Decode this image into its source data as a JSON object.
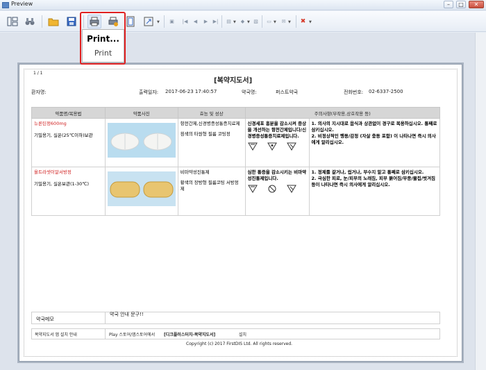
{
  "window": {
    "title": "Preview",
    "min": "–",
    "max": "□",
    "close": "✕"
  },
  "toolbar": {
    "icons": [
      "panes-icon",
      "binoculars-icon",
      "open-folder-icon",
      "save-icon",
      "print-icon",
      "quick-print-icon",
      "page-setup-icon",
      "scale-icon"
    ]
  },
  "print_menu": {
    "item_primary": "Print...",
    "item_secondary": "Print"
  },
  "document": {
    "page_counter": "1 / 1",
    "title": "[복약지도서]",
    "header": {
      "patient_label": "환자명:",
      "print_date_label": "출력일자:",
      "print_date_value": "2017-06-23 17:40:57",
      "pharmacy_label": "약국명:",
      "pharmacy_value": "퍼스트약국",
      "phone_label": "전화번호:",
      "phone_value": "02-6337-2500"
    },
    "columns": [
      "약품명/복용법",
      "약품사진",
      "효능 및 성상",
      "주의사항(부작용,상호작용 등)"
    ],
    "rows": [
      {
        "name": "뉴론틴정600mg",
        "storage": "기밀용기, 실온(25℃이하)보관",
        "efficacy": "항전간제,신경병증성통증치료제",
        "appearance": "흰색의 타원형 필름 코팅정",
        "effect_note": "신경세포 흥분을 감소시켜 증상을 개선하는 항전간제입니다/신경병증성통증치료제입니다.",
        "cautions": "1. 의사의 지시대로 음식과 상관없이 경구로 복용하십시오. 통째로 삼키십시오.\n2. 비정상적인 행동/감정 (자살 충동 포함) 이 나타나면 즉시 의사에게 알리십시오."
      },
      {
        "name": "올트라셋이알서방정",
        "storage": "기밀용기, 실온보관(1-30℃)",
        "efficacy": "비마약성진통제",
        "appearance": "황색의 장방형 필름코팅 서방정제",
        "effect_note": "심한 통증을 감소시키는 비마약성진통제입니다.",
        "cautions": "1. 정제를 갈거나, 씹거나, 부수지 말고 통째로 삼키십시오.\n2. 극심한 피로, 눈/피부의 노래짐, 피부 붉어짐/부종/물집/벗겨짐 등이 나타나면 즉시 의사에게 알리십시오."
      }
    ],
    "memo_label": "약국메모",
    "memo_value": "약국 안내 문구!!",
    "app_label": "복약지도서 앱 설치 안내",
    "app_text_prefix": "Play 스토어/앱스토어에서",
    "app_text_name": "[디크플러스터치-복약지도서]",
    "app_text_suffix": "설치",
    "copyright": "Copyright (c) 2017 FirstDIS Ltd. All rights reserved."
  }
}
